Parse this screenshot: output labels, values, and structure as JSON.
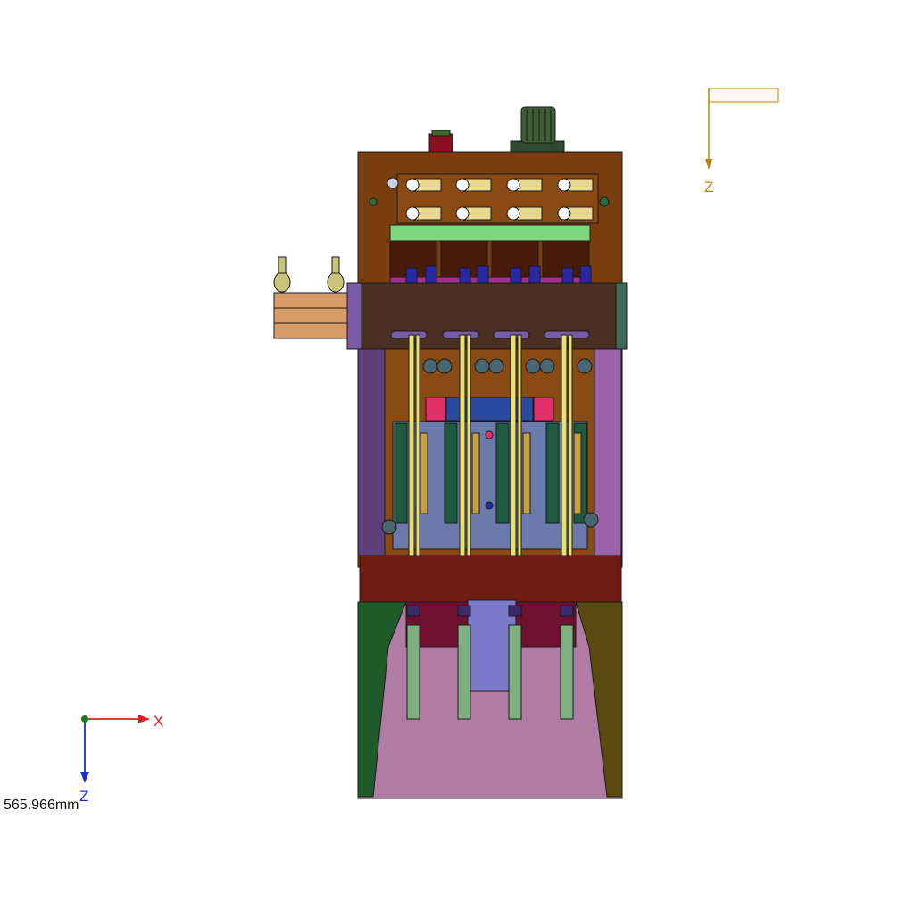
{
  "viewport": {
    "scale_readout": "565.966mm"
  },
  "triad": {
    "x_label": "X",
    "z_label": "Z",
    "x_color": "#e0201b",
    "z_color": "#1a2ec8",
    "origin_color": "#1a7a1a"
  },
  "view_indicator": {
    "z_label": "Z",
    "color": "#b8860b"
  },
  "colors": {
    "body_brown": "#7a3d0e",
    "frame_dark": "#4a3020",
    "panel_purple": "#7b5aa6",
    "base_red": "#6e1d12",
    "skirt_pink": "#b07ca4",
    "cylinder_blue": "#7b79c9",
    "board_green": "#7fd67f",
    "rail_yellow": "#e8e070"
  }
}
